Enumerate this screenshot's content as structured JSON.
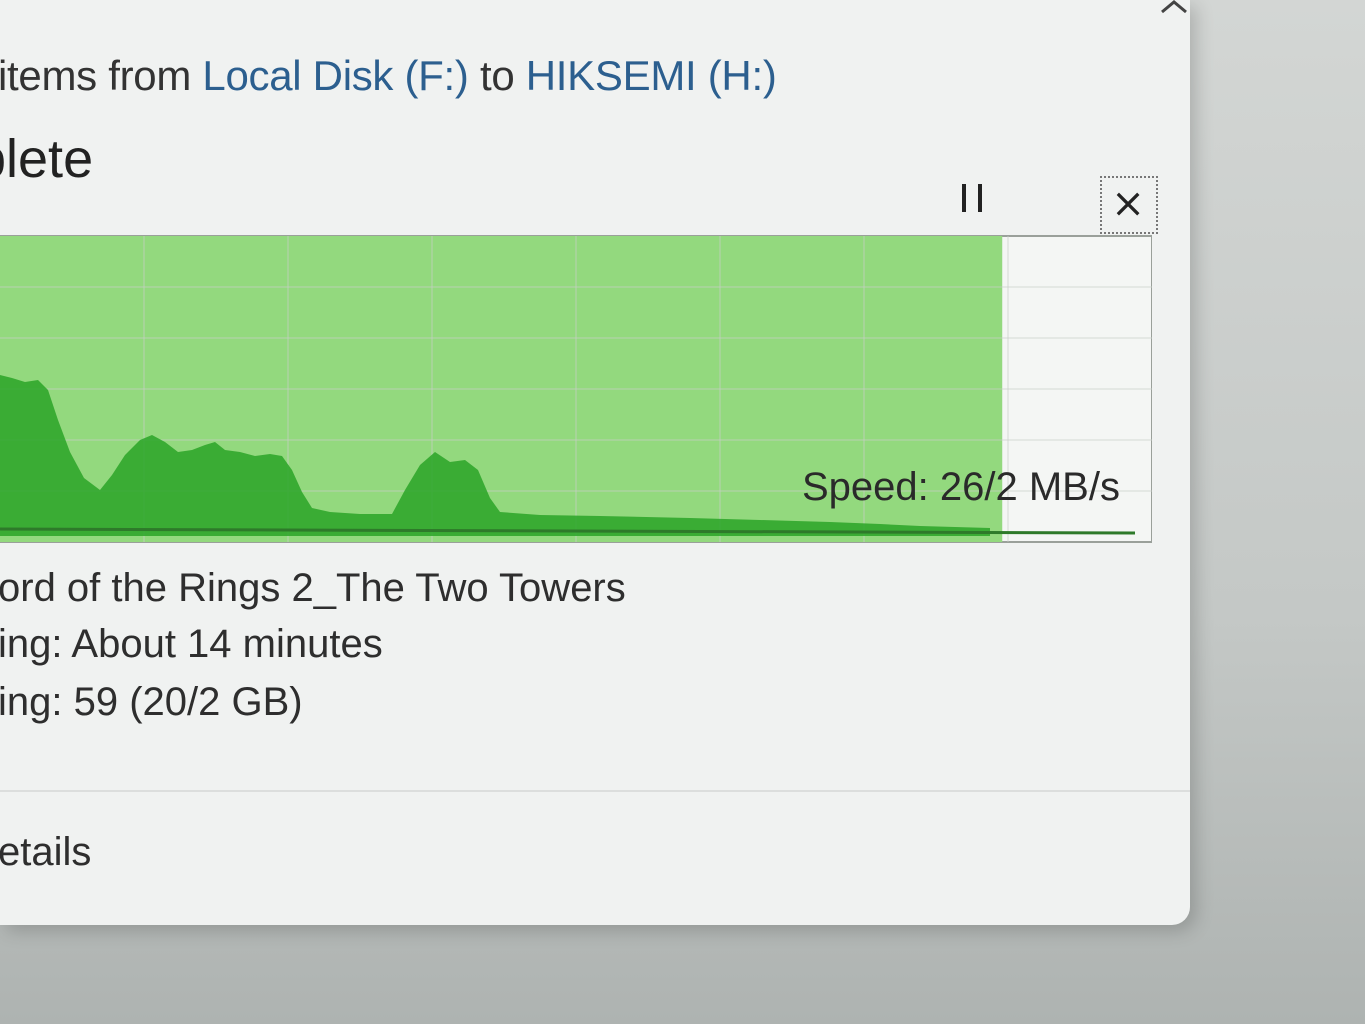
{
  "dialog": {
    "subtitle_prefix": "items from ",
    "source": "Local Disk (F:)",
    "connector": " to ",
    "destination": "HIKSEMI (H:)",
    "headline": "plete",
    "pause_label": "II",
    "close_label": "✕"
  },
  "progress": {
    "fraction_complete": 0.87,
    "speed_text": "Speed: 26/2 MB/s"
  },
  "details": {
    "name_line": "ord of the Rings 2_The Two Towers",
    "time_line": "ing: About 14 minutes",
    "items_line": "ing: 59 (20/2 GB)",
    "toggle_label": "etails"
  },
  "colors": {
    "progress_fill": "#93d97e",
    "speed_area": "#2ea52a",
    "grid": "#c8cfc8"
  },
  "icons": {
    "chevron": "chevron-up-icon",
    "pause": "pause-icon",
    "close": "close-icon"
  }
}
